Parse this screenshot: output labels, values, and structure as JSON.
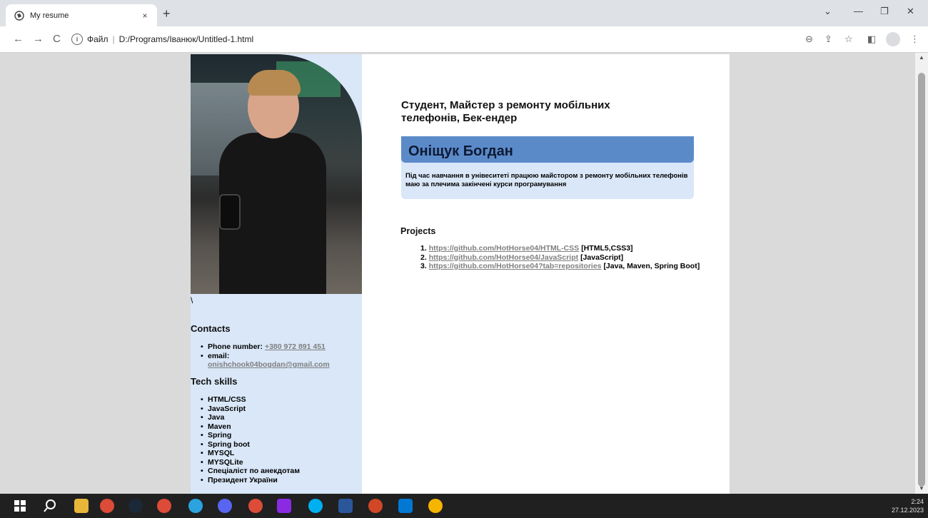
{
  "browser": {
    "tab_title": "My resume",
    "tab_close": "×",
    "new_tab": "+",
    "address_label": "Файл",
    "address_path": "D:/Programs/Іванюк/Untitled-1.html",
    "win_min": "—",
    "win_max": "❐",
    "win_close": "✕",
    "win_chevron": "⌄"
  },
  "resume": {
    "headline": "Студент, Майстер з ремонту мобільних телефонів, Бек-ендер",
    "name": "Оніщук Богдан",
    "description": "Під час навчання в унівеситеті працюю майстором з ремонту мобільних телефонів маю за плечима закінчені курси програмування",
    "backslash": "\\",
    "contacts_heading": "Contacts",
    "phone_label": "Phone number:",
    "phone_value": "+380 972 891 451",
    "email_label": "email:",
    "email_value": "onishchook04bogdan@gmail.com",
    "skills_heading": "Tech skills",
    "skills": [
      "HTML/CSS",
      "JavaScript",
      "Java",
      "Maven",
      "Spring",
      "Spring boot",
      "MYSQL",
      "MYSQLite",
      "Спеціаліст по анекдотам",
      "Президент України"
    ],
    "projects_heading": "Projects",
    "projects": [
      {
        "num": "1.",
        "url": "https://github.com/HotHorse04/HTML-CSS",
        "tag": "[HTML5,CSS3]"
      },
      {
        "num": "2.",
        "url": "https://github.com/HotHorse04/JavaScript",
        "tag": "[JavaScript]"
      },
      {
        "num": "3.",
        "url": "https://github.com/HotHorse04?tab=repositories",
        "tag": "[Java, Maven, Spring Boot]"
      }
    ]
  },
  "taskbar": {
    "time": "2:24",
    "date": "27.12.2023",
    "apps": [
      "windows-start-icon",
      "search-icon",
      "file-explorer-icon",
      "chrome-icon",
      "steam-icon",
      "chrome-icon",
      "telegram-icon",
      "discord-icon",
      "chrome-icon",
      "winrar-icon",
      "skype-icon",
      "word-icon",
      "powerpoint-icon",
      "vscode-icon",
      "chrome-canary-icon"
    ]
  },
  "colors": {
    "sidebar_bg": "#d9e7f8",
    "name_bar": "#5b8ac9",
    "link": "#7f7f7f"
  }
}
